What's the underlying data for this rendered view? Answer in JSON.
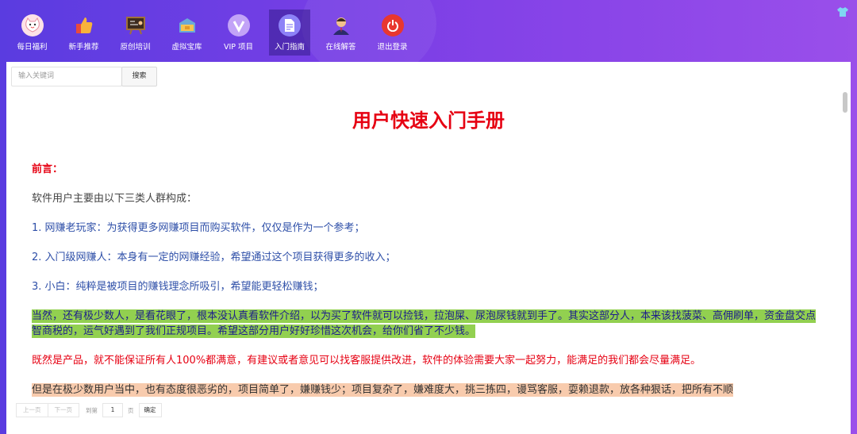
{
  "nav": {
    "items": [
      {
        "label": "每日福利",
        "icon": "cat-icon",
        "color": "#f4b6c2"
      },
      {
        "label": "新手推荐",
        "icon": "thumbs-up-icon",
        "color": "#f5a623"
      },
      {
        "label": "原创培训",
        "icon": "blackboard-icon",
        "color": "#6b4a2a"
      },
      {
        "label": "虚拟宝库",
        "icon": "treasure-box-icon",
        "color": "#f3c35a"
      },
      {
        "label": "VIP 项目",
        "icon": "vip-icon",
        "color": "#b98cf5"
      },
      {
        "label": "入门指南",
        "icon": "document-icon",
        "color": "#8b7cf6"
      },
      {
        "label": "在线解答",
        "icon": "support-agent-icon",
        "color": "#e8b47a"
      },
      {
        "label": "退出登录",
        "icon": "power-icon",
        "color": "#e8372f"
      }
    ],
    "active_index": 5
  },
  "search": {
    "placeholder": "输入关键词",
    "button": "搜索"
  },
  "document": {
    "title": "用户快速入门手册",
    "preface": "前言：",
    "intro": "软件用户主要由以下三类人群构成：",
    "points": [
      "1. 网赚老玩家：为获得更多网赚项目而购买软件，仅仅是作为一个参考；",
      "2. 入门级网赚人：本身有一定的网赚经验，希望通过这个项目获得更多的收入；",
      "3. 小白：纯粹是被项目的赚钱理念所吸引，希望能更轻松赚钱；"
    ],
    "green_text": "当然，还有极少数人，是看花眼了，根本没认真看软件介绍，以为买了软件就可以捡钱，拉泡屎、尿泡尿钱就到手了。其实这部分人，本来该找菠菜、高佣刷单，资金盘交点智商税的，运气好遇到了我们正规项目。希望这部分用户好好珍惜这次机会，给你们省了不少钱。",
    "red_text": "既然是产品，就不能保证所有人100%都满意，有建议或者意见可以找客服提供改进，软件的体验需要大家一起努力，能满足的我们都会尽量满足。",
    "peach_text": "但是在极少数用户当中，也有态度很恶劣的，项目简单了，嫌赚钱少；项目复杂了，嫌难度大，挑三拣四，谩骂客服，耍赖退款，放各种狠话，把所有不顺"
  },
  "pager": {
    "prev": "上一页",
    "next": "下一页",
    "goto": "到第",
    "page_value": "1",
    "page_unit": "页",
    "confirm": "确定"
  }
}
